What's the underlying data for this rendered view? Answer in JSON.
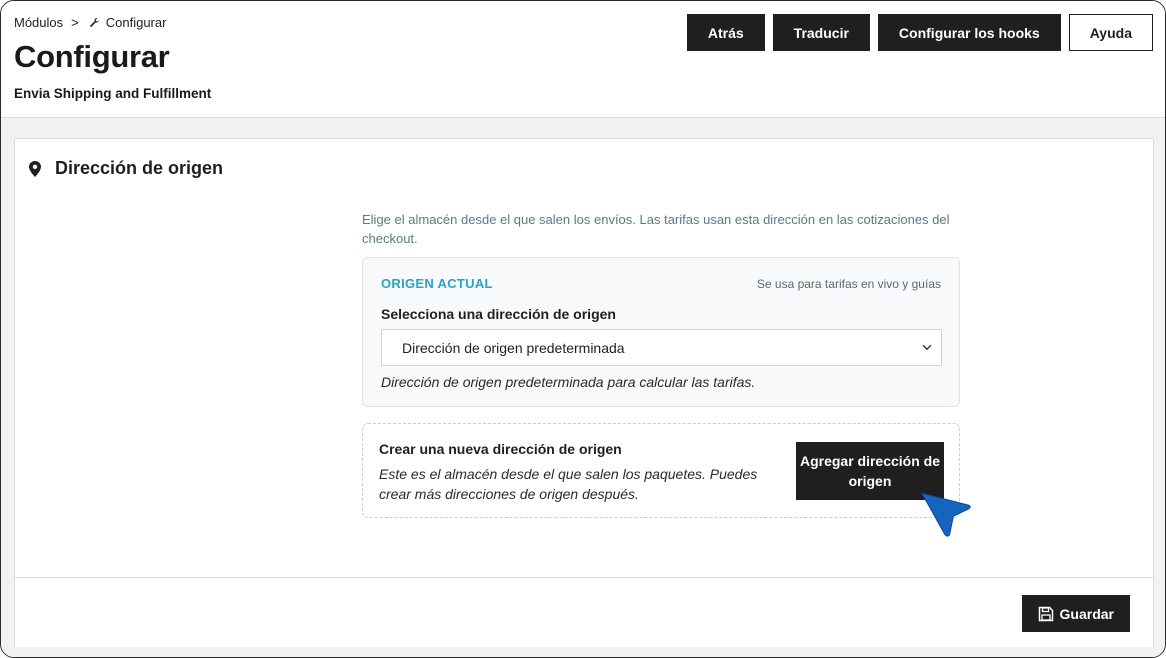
{
  "breadcrumb": {
    "parent": "Módulos",
    "separator": ">",
    "current": "Configurar"
  },
  "header": {
    "title": "Configurar",
    "subtitle": "Envia Shipping and Fulfillment"
  },
  "toolbar": {
    "back_label": "Atrás",
    "translate_label": "Traducir",
    "hooks_label": "Configurar los hooks",
    "help_label": "Ayuda"
  },
  "panel": {
    "title": "Dirección de origen",
    "help_text": "Elige el almacén desde el que salen los envíos. Las tarifas usan esta dirección en las cotizaciones del checkout.",
    "origin": {
      "label": "ORIGEN ACTUAL",
      "note": "Se usa para tarifas en vivo y guías",
      "select_label": "Selecciona una dirección de origen",
      "selected_value": "Dirección de origen predeterminada",
      "select_help": "Dirección de origen predeterminada para calcular las tarifas."
    },
    "create": {
      "title": "Crear una nueva dirección de origen",
      "description": "Este es el almacén desde el que salen los paquetes. Puedes crear más direcciones de origen después.",
      "button_label": "Agregar dirección de origen"
    },
    "footer": {
      "save_label": "Guardar"
    }
  },
  "colors": {
    "primary_button": "#1f1f1f",
    "accent": "#26a4c9",
    "cursor": "#1565c0"
  }
}
